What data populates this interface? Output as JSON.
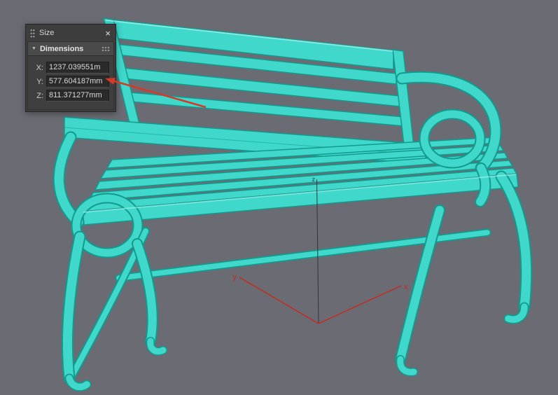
{
  "viewport": {
    "background_color": "#6b6b73",
    "selection_color": "#3fd8cb",
    "selection_outline_color": "#129a8e",
    "axis_color": "#c8281c",
    "axis_labels": {
      "x": "x",
      "y": "y",
      "z": "z"
    }
  },
  "panel": {
    "title": "Size",
    "close_glyph": "×",
    "rollout": {
      "title": "Dimensions",
      "collapse_glyph": "▼"
    },
    "rows": [
      {
        "label": "X:",
        "value": "1237.039551m"
      },
      {
        "label": "Y:",
        "value": "577.604187mm"
      },
      {
        "label": "Z:",
        "value": "811.371277mm"
      }
    ]
  },
  "annotation": {
    "arrow_color": "#d43a28"
  }
}
